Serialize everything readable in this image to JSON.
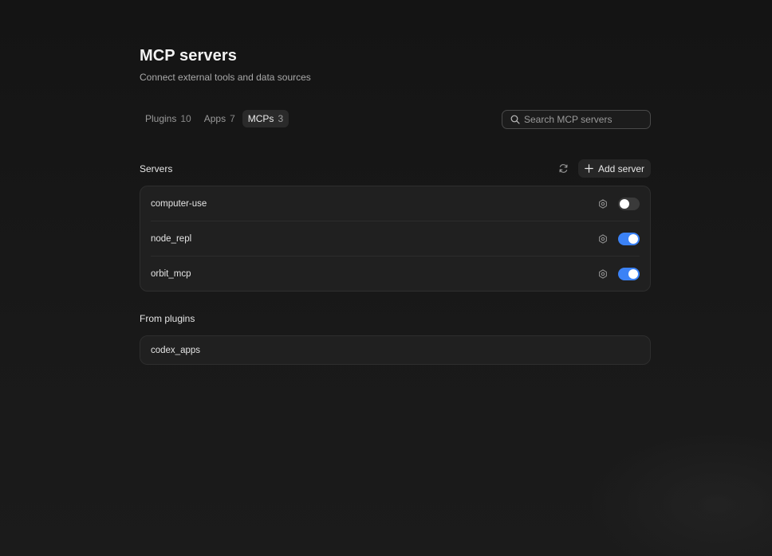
{
  "header": {
    "title": "MCP servers",
    "subtitle": "Connect external tools and data sources"
  },
  "tabs": [
    {
      "label": "Plugins",
      "count": "10",
      "active": false
    },
    {
      "label": "Apps",
      "count": "7",
      "active": false
    },
    {
      "label": "MCPs",
      "count": "3",
      "active": true
    }
  ],
  "search": {
    "placeholder": "Search MCP servers",
    "value": "",
    "icon": "search-icon"
  },
  "servers_section": {
    "title": "Servers",
    "refresh_icon": "refresh-icon",
    "add_label": "Add server",
    "items": [
      {
        "name": "computer-use",
        "enabled": false
      },
      {
        "name": "node_repl",
        "enabled": true
      },
      {
        "name": "orbit_mcp",
        "enabled": true
      }
    ]
  },
  "plugins_section": {
    "title": "From plugins",
    "items": [
      {
        "name": "codex_apps"
      }
    ]
  },
  "colors": {
    "background": "#181818",
    "card": "#202020",
    "accent": "#3b82f6"
  }
}
